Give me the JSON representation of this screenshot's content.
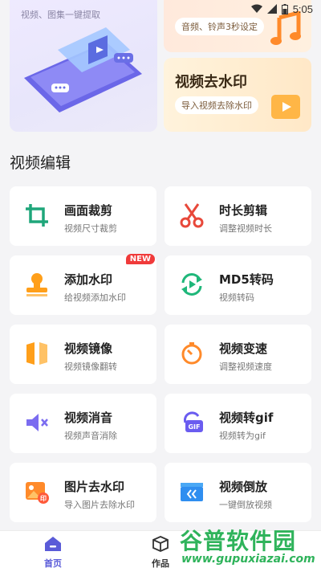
{
  "status_bar": {
    "time": "5:05"
  },
  "banners": {
    "left_subtitle": "视频、图集一键提取",
    "top_right_pill": "音频、铃声3秒设定",
    "bottom_right": {
      "title": "视频去水印",
      "pill": "导入视频去除水印"
    }
  },
  "section_title": "视频编辑",
  "tools": [
    {
      "title": "画面裁剪",
      "subtitle": "视频尺寸裁剪",
      "icon": "crop-icon"
    },
    {
      "title": "时长剪辑",
      "subtitle": "调整视频时长",
      "icon": "scissors-icon"
    },
    {
      "title": "添加水印",
      "subtitle": "给视频添加水印",
      "icon": "stamp-icon",
      "badge": "NEW"
    },
    {
      "title": "MD5转码",
      "subtitle": "视频转码",
      "icon": "transcode-icon"
    },
    {
      "title": "视频镜像",
      "subtitle": "视频镜像翻转",
      "icon": "mirror-icon"
    },
    {
      "title": "视频变速",
      "subtitle": "调整视频速度",
      "icon": "speed-icon"
    },
    {
      "title": "视频消音",
      "subtitle": "视频声音消除",
      "icon": "mute-icon"
    },
    {
      "title": "视频转gif",
      "subtitle": "视频转为gif",
      "icon": "gif-icon"
    },
    {
      "title": "图片去水印",
      "subtitle": "导入图片去除水印",
      "icon": "image-watermark-icon"
    },
    {
      "title": "视频倒放",
      "subtitle": "一键倒放视频",
      "icon": "rewind-icon"
    }
  ],
  "nav": {
    "home": "首页",
    "works": "作品"
  },
  "watermark": {
    "title": "谷普软件园",
    "url": "www.gupuxiazai.com"
  },
  "colors": {
    "accent": "#5a5bd8",
    "orange": "#ff9f1a",
    "red": "#f03a3a",
    "green": "#1fb77a"
  }
}
